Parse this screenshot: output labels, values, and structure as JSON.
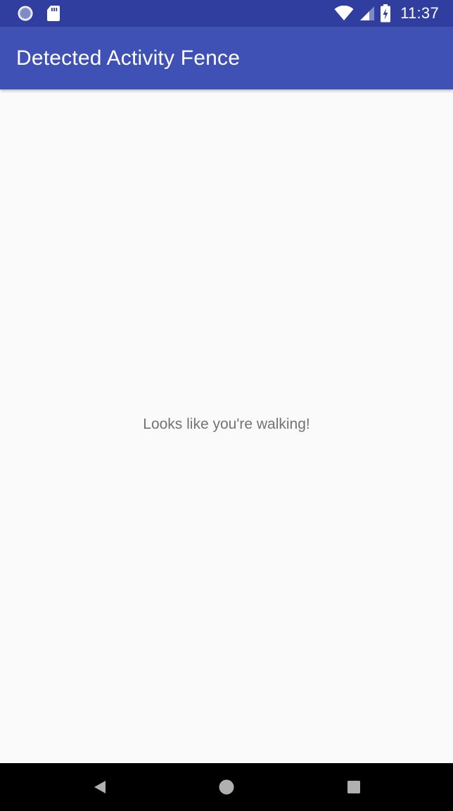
{
  "status_bar": {
    "time": "11:37",
    "icons": {
      "left": [
        "sync-icon",
        "sd-card-icon"
      ],
      "right": [
        "wifi-icon",
        "cell-signal-icon",
        "battery-charging-icon"
      ]
    }
  },
  "app_bar": {
    "title": "Detected Activity Fence"
  },
  "content": {
    "message": "Looks like you're walking!"
  },
  "nav_bar": {
    "icons": [
      "back-icon",
      "home-icon",
      "recents-icon"
    ]
  },
  "colors": {
    "status_bar": "#303f9f",
    "app_bar": "#3f51b5",
    "background": "#fafafa",
    "message_text": "#737373",
    "nav_bar": "#000000"
  }
}
